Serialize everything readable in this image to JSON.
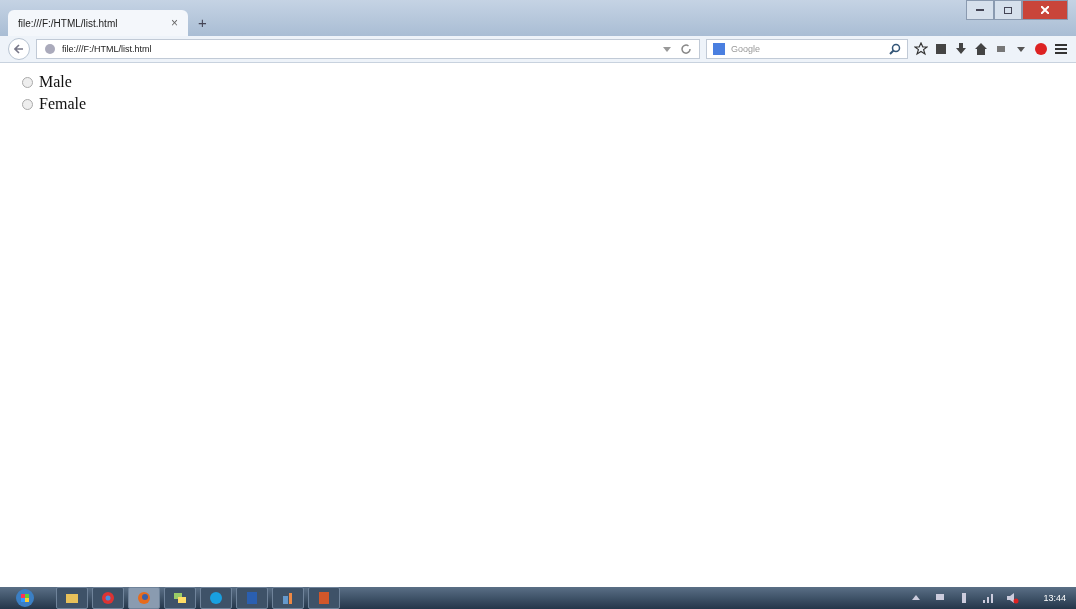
{
  "browser": {
    "tab": {
      "title": "file:///F:/HTML/list.html",
      "close": "×",
      "selected": true
    },
    "new_tab": "+",
    "address": "file:///F:/HTML/list.html",
    "search": {
      "placeholder": "Google"
    }
  },
  "page": {
    "radios": [
      {
        "label": "Male",
        "selected": false
      },
      {
        "label": "Female",
        "selected": false
      }
    ]
  },
  "taskbar": {
    "apps": [
      {
        "kind": "folder",
        "active": false
      },
      {
        "kind": "chrome",
        "active": false
      },
      {
        "kind": "firefox",
        "active": true
      },
      {
        "kind": "chat",
        "active": false
      },
      {
        "kind": "skype",
        "active": false
      },
      {
        "kind": "word",
        "active": false
      },
      {
        "kind": "paint",
        "active": false
      },
      {
        "kind": "powerpoint",
        "active": false
      }
    ],
    "clock": "13:44"
  }
}
